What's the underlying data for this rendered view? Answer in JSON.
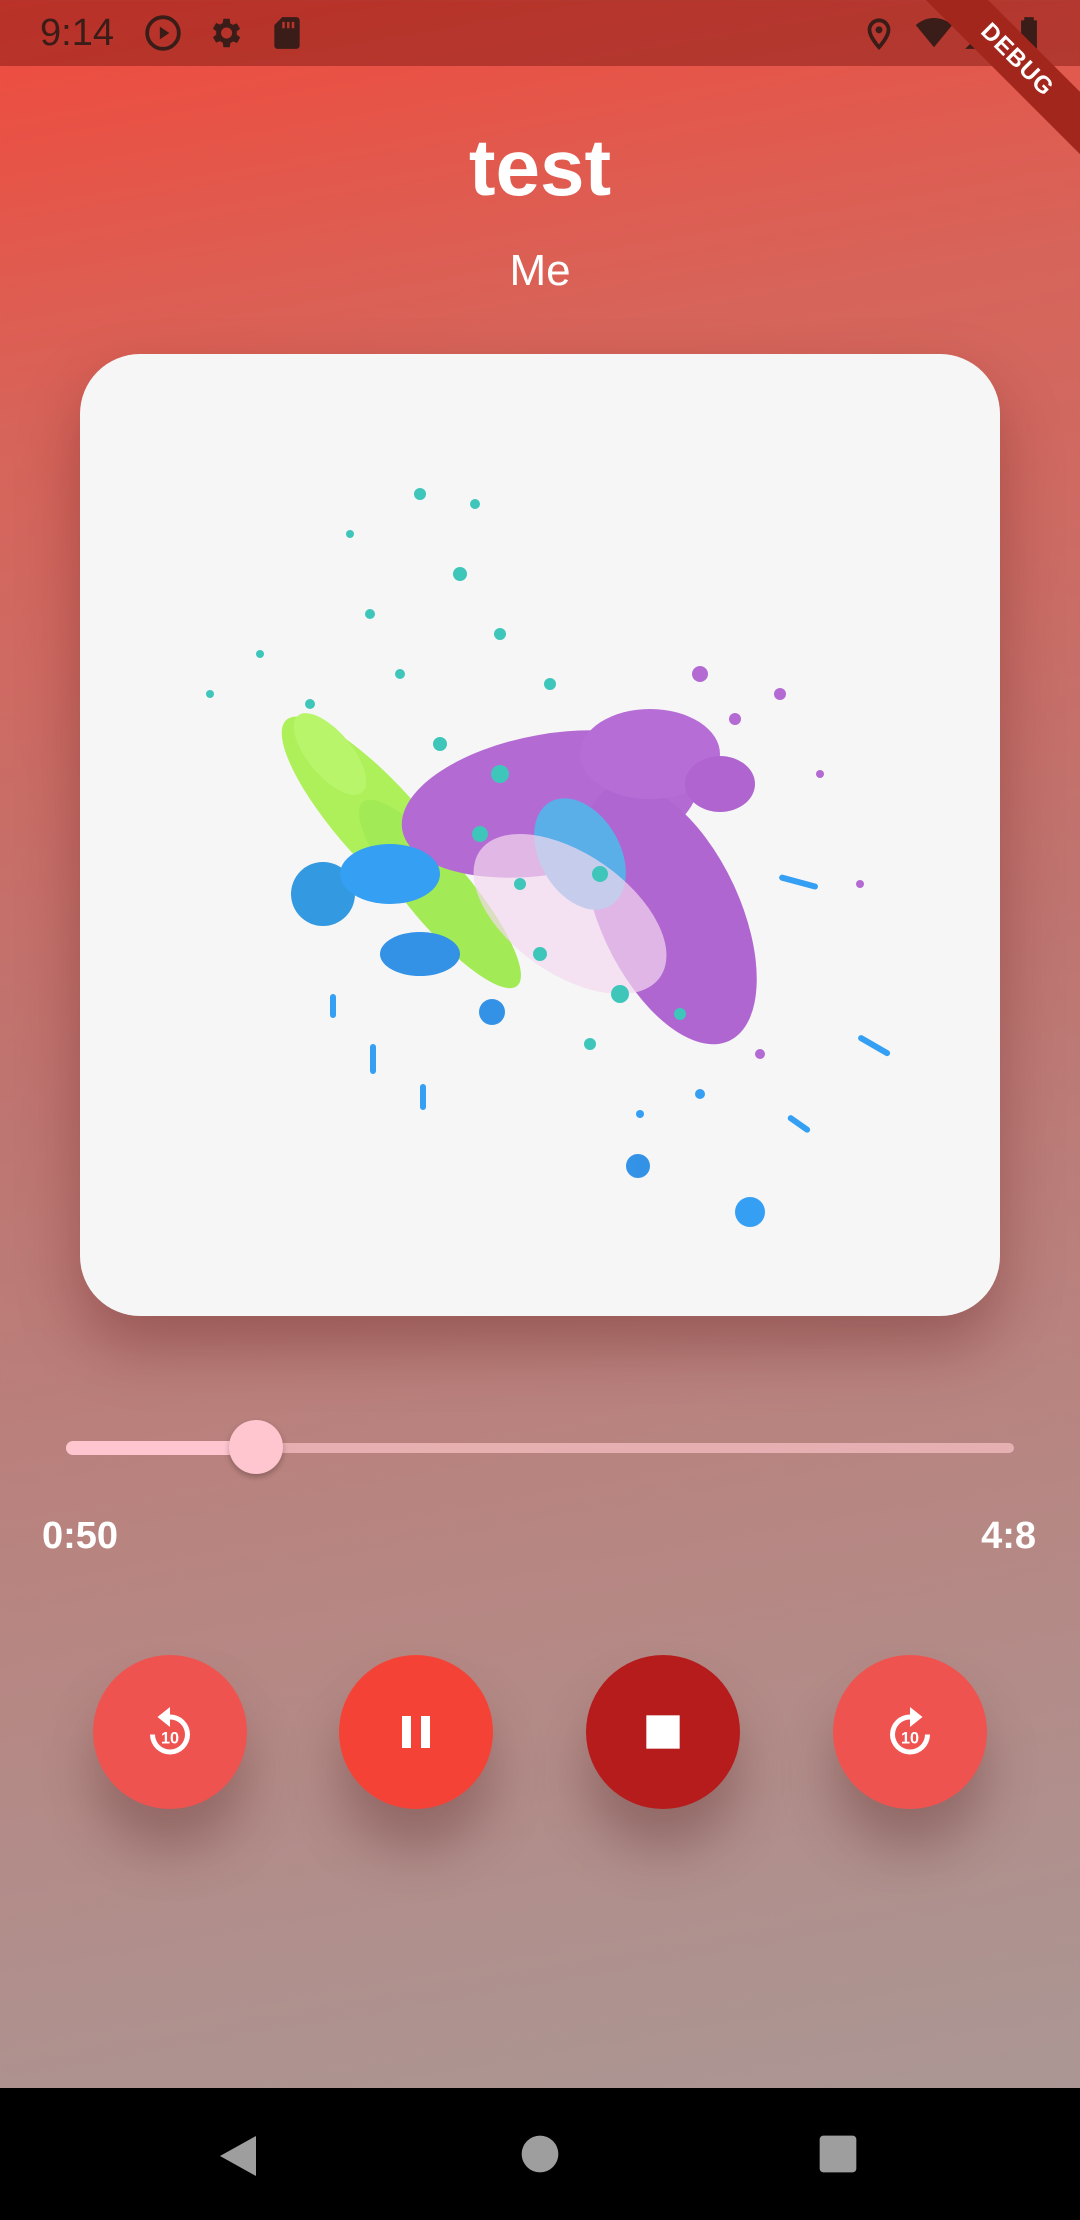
{
  "status_bar": {
    "time": "9:14",
    "icons": [
      "play-circle-icon",
      "gear-icon",
      "sd-card-icon",
      "location-icon",
      "wifi-icon",
      "signal-icon",
      "battery-icon"
    ]
  },
  "debug_banner": "DEBUG",
  "track": {
    "title": "test",
    "artist": "Me"
  },
  "player": {
    "position": "0:50",
    "duration": "4:8",
    "progress_fraction": 0.2
  },
  "controls": [
    {
      "name": "replay-10-button",
      "icon": "replay-10-icon",
      "label": "10",
      "color": "#ef5350"
    },
    {
      "name": "pause-button",
      "icon": "pause-icon",
      "color": "#f44336"
    },
    {
      "name": "stop-button",
      "icon": "stop-icon",
      "color": "#b71c1c"
    },
    {
      "name": "forward-10-button",
      "icon": "forward-10-icon",
      "label": "10",
      "color": "#ef5350"
    }
  ],
  "navigation": [
    "back-icon",
    "home-icon",
    "recents-icon"
  ],
  "colors": {
    "accent": "#f44336",
    "slider": "#ffc6cf",
    "album_background": "#f6f6f6"
  }
}
